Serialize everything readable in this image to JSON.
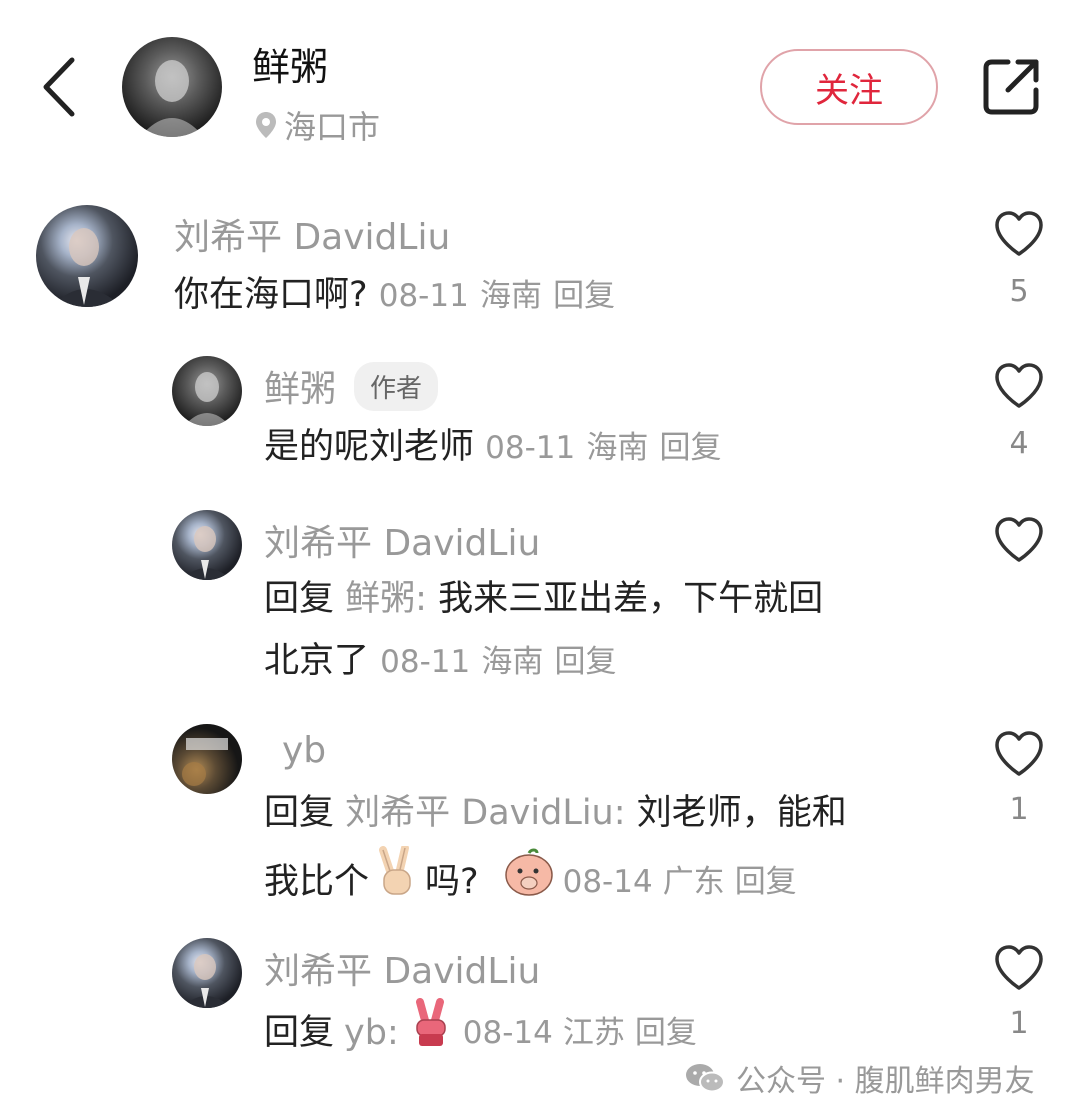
{
  "header": {
    "username": "鲜粥",
    "location": "海口市",
    "follow_label": "关注"
  },
  "comments": [
    {
      "name": "刘希平 DavidLiu",
      "text": "你在海口啊?",
      "date": "08-11",
      "region": "海南",
      "reply_label": "回复",
      "likes": "5"
    },
    {
      "name": "鲜粥",
      "badge": "作者",
      "text": "是的呢刘老师",
      "date": "08-11",
      "region": "海南",
      "reply_label": "回复",
      "likes": "4"
    },
    {
      "name": "刘希平 DavidLiu",
      "reply_prefix": "回复",
      "reply_to": "鲜粥:",
      "text_line1": "我来三亚出差，下午就回",
      "text_line2": "北京了",
      "date": "08-11",
      "region": "海南",
      "reply_label": "回复"
    },
    {
      "name": "yb",
      "reply_prefix": "回复",
      "reply_to": "刘希平 DavidLiu:",
      "text_line1": "刘老师，能和",
      "text_line2a": "我比个",
      "text_line2b": "吗?",
      "date": "08-14",
      "region": "广东",
      "reply_label": "回复",
      "likes": "1"
    },
    {
      "name": "刘希平 DavidLiu",
      "reply_prefix": "回复",
      "reply_to": "yb:",
      "date": "08-14",
      "region": "江苏",
      "reply_label": "回复",
      "likes": "1"
    }
  ],
  "watermark": "公众号 · 腹肌鲜肉男友",
  "icons": {
    "back": "chevron-left-icon",
    "location": "location-pin-icon",
    "share": "share-external-icon",
    "like": "heart-outline-icon",
    "victory": "victory-hand-emoji",
    "peach": "peach-face-emoji",
    "wechat": "wechat-icon"
  },
  "colors": {
    "follow_text": "#e0263c",
    "follow_border": "#e0a3a9",
    "secondary_text": "#999999"
  }
}
